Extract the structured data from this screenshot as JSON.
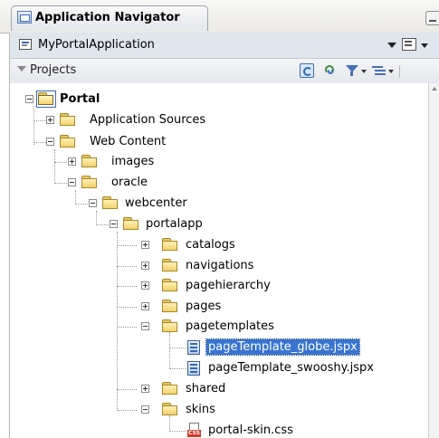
{
  "panel": {
    "title": "Application Navigator",
    "application": "MyPortalApplication",
    "section": "Projects"
  },
  "toolbar_icons": [
    "sync-selection-icon",
    "refresh-icon",
    "filter-icon",
    "levels-icon"
  ],
  "tree": {
    "root": "Portal",
    "application_sources": "Application Sources",
    "web_content": "Web Content",
    "images": "images",
    "oracle": "oracle",
    "webcenter": "webcenter",
    "portalapp": "portalapp",
    "catalogs": "catalogs",
    "navigations": "navigations",
    "pagehierarchy": "pagehierarchy",
    "pages": "pages",
    "pagetemplates": "pagetemplates",
    "template_globe": "pageTemplate_globe.jspx",
    "template_swooshy": "pageTemplate_swooshy.jspx",
    "shared": "shared",
    "skins": "skins",
    "skin_css": "portal-skin.css",
    "css_badge": "CSS"
  },
  "colors": {
    "selection": "#3974d1",
    "folder": "#f1d36b"
  }
}
